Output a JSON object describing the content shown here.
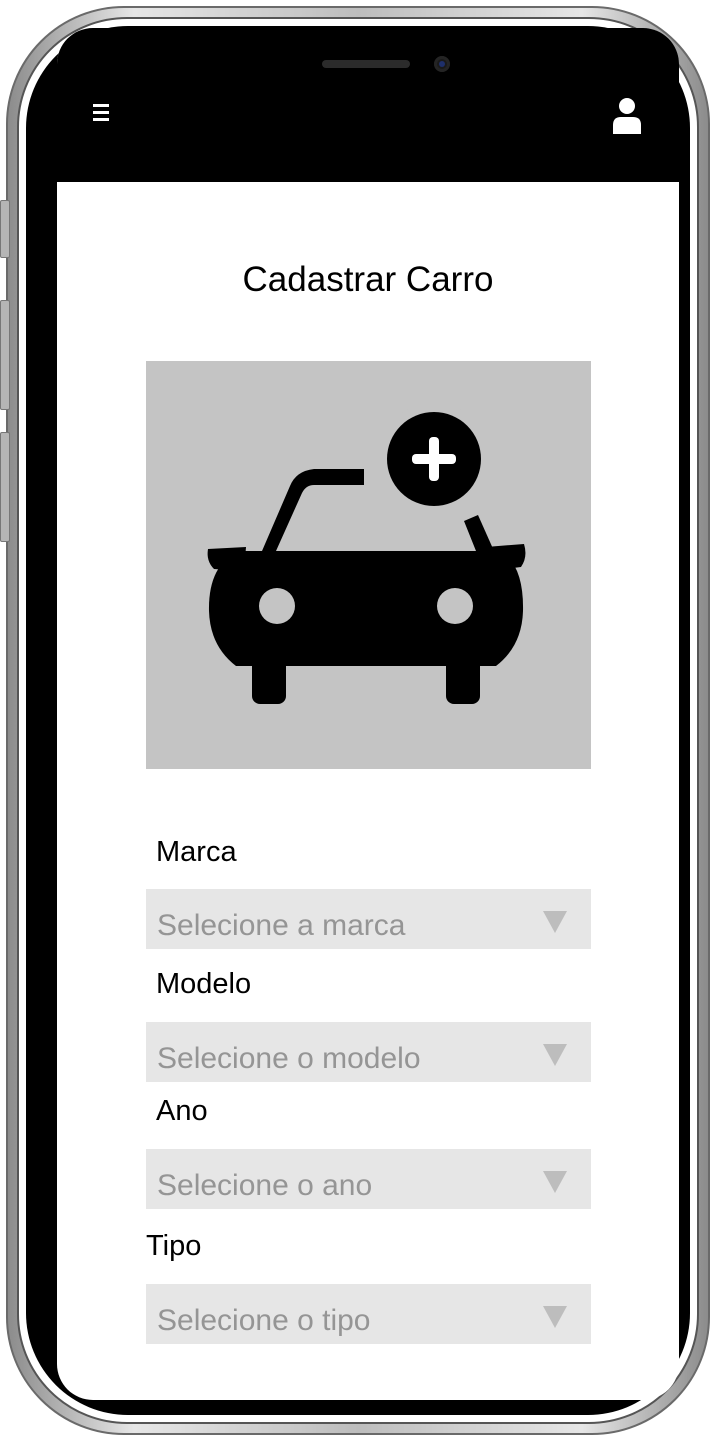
{
  "header": {
    "menu_icon": "hamburger-menu-icon",
    "user_icon": "user-icon"
  },
  "page": {
    "title": "Cadastrar Carro"
  },
  "image": {
    "icon": "car-add-icon"
  },
  "form": {
    "fields": [
      {
        "label": "Marca",
        "placeholder": "Selecione a marca"
      },
      {
        "label": "Modelo",
        "placeholder": "Selecione o modelo"
      },
      {
        "label": "Ano",
        "placeholder": "Selecione o ano"
      },
      {
        "label": "Tipo",
        "placeholder": "Selecione o tipo"
      }
    ]
  },
  "colors": {
    "statusbar": "#000000",
    "image_background": "#c4c4c4",
    "select_background": "#e6e6e6",
    "placeholder_text": "#959595"
  }
}
